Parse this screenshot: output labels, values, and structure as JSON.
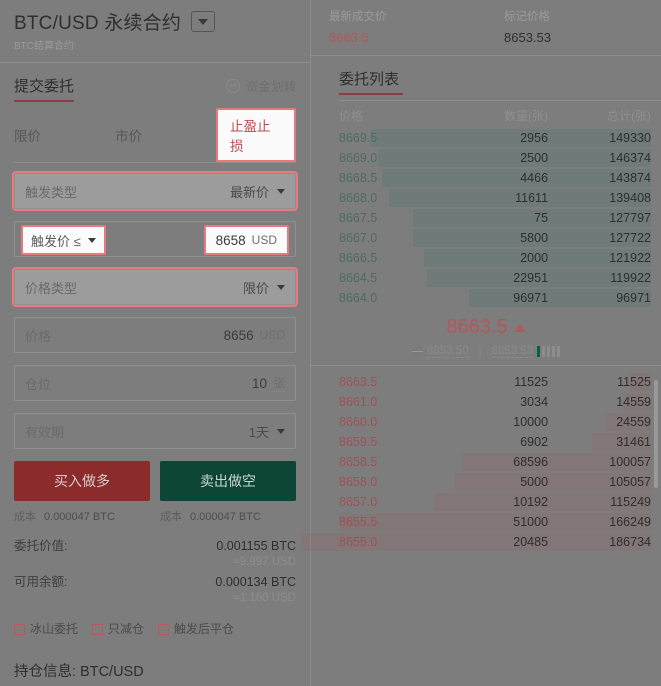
{
  "header": {
    "pair_title": "BTC/USD 永续合约",
    "subtitle": "BTC结算合约",
    "dropdown_icon": "chevron-down-icon"
  },
  "ticker": {
    "last_price_label": "最新成交价",
    "last_price_value": "8663.5",
    "mark_price_label": "标记价格",
    "mark_price_value": "8653.53"
  },
  "order_form": {
    "section_title": "提交委托",
    "transfer_label": "资金划转",
    "transfer_icon": "transfer-icon",
    "tabs": [
      {
        "label": "限价",
        "active": false
      },
      {
        "label": "市价",
        "active": false
      },
      {
        "label": "止盈止损",
        "active": true
      }
    ],
    "trigger_type": {
      "label": "触发类型",
      "value": "最新价"
    },
    "trigger_price": {
      "label": "触发价 ≤",
      "value": "8658",
      "unit": "USD"
    },
    "price_type": {
      "label": "价格类型",
      "value": "限价"
    },
    "price": {
      "label": "价格",
      "value": "8656",
      "unit": "USD"
    },
    "position_size": {
      "label": "仓位",
      "value": "10",
      "unit": "张"
    },
    "validity": {
      "label": "有效期",
      "value": "1天"
    },
    "buy_button": "买入做多",
    "sell_button": "卖出做空",
    "cost_label": "成本",
    "cost_buy": "0.000047 BTC",
    "cost_sell": "0.000047 BTC",
    "order_value_label": "委托价值:",
    "order_value": "0.001155 BTC",
    "order_value_usd": "≈9.997 USD",
    "available_label": "可用余额:",
    "available_value": "0.000134 BTC",
    "available_usd": "≈1.160 USD",
    "checkboxes": [
      {
        "label": "冰山委托",
        "checked": false
      },
      {
        "label": "只减仓",
        "checked": false
      },
      {
        "label": "触发后平仓",
        "checked": false
      }
    ]
  },
  "position_section": {
    "title": "持仓信息: BTC/USD"
  },
  "order_book": {
    "title": "委托列表",
    "columns": {
      "price": "价格",
      "quantity": "数量(张)",
      "total": "总计(张)"
    },
    "asks": [
      {
        "price": "8669.5",
        "qty": "2956",
        "total": "149330",
        "depth": 80
      },
      {
        "price": "8669.0",
        "qty": "2500",
        "total": "146374",
        "depth": 78
      },
      {
        "price": "8668.5",
        "qty": "4466",
        "total": "143874",
        "depth": 77
      },
      {
        "price": "8668.0",
        "qty": "11611",
        "total": "139408",
        "depth": 75
      },
      {
        "price": "8667.5",
        "qty": "75",
        "total": "127797",
        "depth": 68
      },
      {
        "price": "8667.0",
        "qty": "5800",
        "total": "127722",
        "depth": 68
      },
      {
        "price": "8666.5",
        "qty": "2000",
        "total": "121922",
        "depth": 65
      },
      {
        "price": "8664.5",
        "qty": "22951",
        "total": "119922",
        "depth": 64
      },
      {
        "price": "8664.0",
        "qty": "96971",
        "total": "96971",
        "depth": 52
      }
    ],
    "mid": {
      "price": "8663.5",
      "direction": "up",
      "index_price": "8653.50",
      "mark_price": "8653.53",
      "globe_icon": "globe-icon",
      "signal_bars": 5,
      "signal_active": 1
    },
    "bids": [
      {
        "price": "8663.5",
        "qty": "11525",
        "total": "11525",
        "depth": 6
      },
      {
        "price": "8661.0",
        "qty": "3034",
        "total": "14559",
        "depth": 8
      },
      {
        "price": "8660.0",
        "qty": "10000",
        "total": "24559",
        "depth": 13
      },
      {
        "price": "8659.5",
        "qty": "6902",
        "total": "31461",
        "depth": 17
      },
      {
        "price": "8658.5",
        "qty": "68596",
        "total": "100057",
        "depth": 54
      },
      {
        "price": "8658.0",
        "qty": "5000",
        "total": "105057",
        "depth": 56
      },
      {
        "price": "8657.0",
        "qty": "10192",
        "total": "115249",
        "depth": 62
      },
      {
        "price": "8655.5",
        "qty": "51000",
        "total": "166249",
        "depth": 89
      },
      {
        "price": "8655.0",
        "qty": "20485",
        "total": "186734",
        "depth": 100
      }
    ]
  },
  "colors": {
    "background": "#7d7d7d",
    "ask_price": "#4e6b62",
    "bid_price": "#9c5257",
    "accent_red": "#8e3b43",
    "highlight_border": "#e87a7e",
    "buy_button": "#8c2b2b",
    "sell_button": "#0d4536"
  }
}
